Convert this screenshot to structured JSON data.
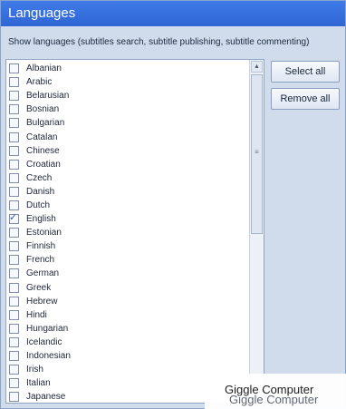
{
  "window": {
    "title": "Languages"
  },
  "description": "Show languages (subtitles search, subtitle publishing, subtitle commenting)",
  "languages": [
    {
      "label": "Albanian",
      "checked": false
    },
    {
      "label": "Arabic",
      "checked": false
    },
    {
      "label": "Belarusian",
      "checked": false
    },
    {
      "label": "Bosnian",
      "checked": false
    },
    {
      "label": "Bulgarian",
      "checked": false
    },
    {
      "label": "Catalan",
      "checked": false
    },
    {
      "label": "Chinese",
      "checked": false
    },
    {
      "label": "Croatian",
      "checked": false
    },
    {
      "label": "Czech",
      "checked": false
    },
    {
      "label": "Danish",
      "checked": false
    },
    {
      "label": "Dutch",
      "checked": false
    },
    {
      "label": "English",
      "checked": true
    },
    {
      "label": "Estonian",
      "checked": false
    },
    {
      "label": "Finnish",
      "checked": false
    },
    {
      "label": "French",
      "checked": false
    },
    {
      "label": "German",
      "checked": false
    },
    {
      "label": "Greek",
      "checked": false
    },
    {
      "label": "Hebrew",
      "checked": false
    },
    {
      "label": "Hindi",
      "checked": false
    },
    {
      "label": "Hungarian",
      "checked": false
    },
    {
      "label": "Icelandic",
      "checked": false
    },
    {
      "label": "Indonesian",
      "checked": false
    },
    {
      "label": "Irish",
      "checked": false
    },
    {
      "label": "Italian",
      "checked": false
    },
    {
      "label": "Japanese",
      "checked": false
    }
  ],
  "buttons": {
    "select_all": "Select all",
    "remove_all": "Remove all"
  },
  "watermark": {
    "line1": "Giggle Computer",
    "line2": "Giggle Computer"
  }
}
